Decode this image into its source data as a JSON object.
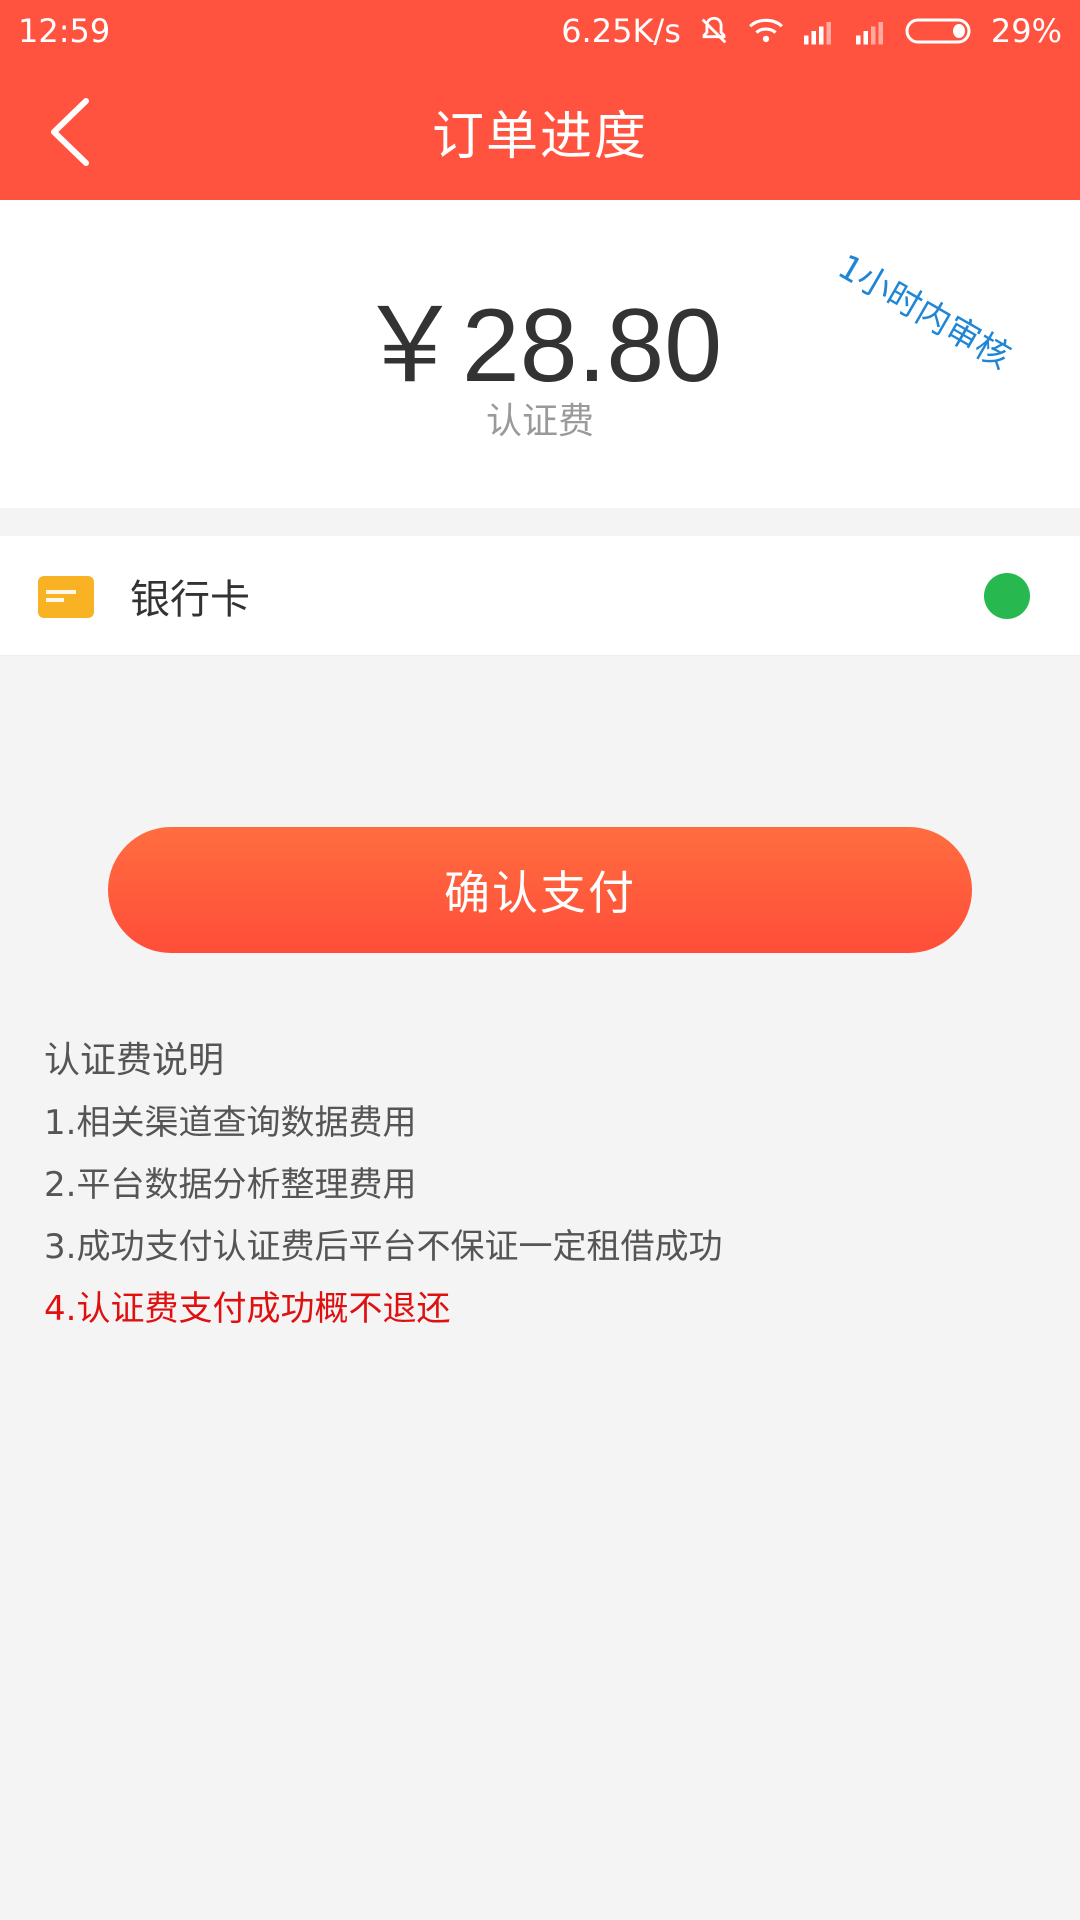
{
  "status_bar": {
    "time": "12:59",
    "network_speed": "6.25K/s",
    "battery": "29%",
    "icons": [
      "bell-off-icon",
      "wifi-icon",
      "signal-icon",
      "signal-icon",
      "battery-icon"
    ]
  },
  "app_bar": {
    "title": "订单进度",
    "back_icon": "chevron-left-icon"
  },
  "amount": {
    "value": "￥28.80",
    "label": "认证费",
    "badge": "1小时内审核"
  },
  "payment_method": {
    "label": "银行卡",
    "icon": "bank-card-icon",
    "selected": true
  },
  "confirm_button": {
    "label": "确认支付"
  },
  "notes": {
    "title": "认证费说明",
    "items": [
      "1.相关渠道查询数据费用",
      "2.平台数据分析整理费用",
      "3.成功支付认证费后平台不保证一定租借成功",
      "4.认证费支付成功概不退还"
    ]
  },
  "colors": {
    "primary": "#ff5340",
    "badge_blue": "#1f86d6",
    "radio_green": "#27b94f",
    "warning_red": "#e01010",
    "card_yellow": "#f8b223"
  }
}
